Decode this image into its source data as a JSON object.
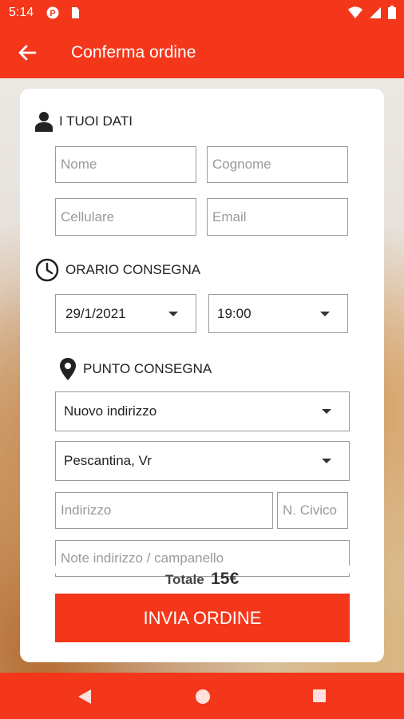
{
  "status_bar": {
    "time": "5:14"
  },
  "app_bar": {
    "title": "Conferma ordine"
  },
  "section_personal": {
    "title": "I TUOI DATI",
    "first_name_placeholder": "Nome",
    "last_name_placeholder": "Cognome",
    "phone_placeholder": "Cellulare",
    "email_placeholder": "Email"
  },
  "section_time": {
    "title": "ORARIO CONSEGNA",
    "date_value": "29/1/2021",
    "time_value": "19:00"
  },
  "section_delivery": {
    "title": "PUNTO CONSEGNA",
    "address_type": "Nuovo indirizzo",
    "city": "Pescantina, Vr",
    "address_placeholder": "Indirizzo",
    "civic_placeholder": "N. Civico",
    "notes_placeholder": "Note indirizzo / campanello"
  },
  "total": {
    "label": "Totale",
    "amount": "15€"
  },
  "submit_label": "INVIA ORDINE",
  "colors": {
    "accent": "#f4371b",
    "border": "#9a9a9a",
    "text": "#222222"
  }
}
